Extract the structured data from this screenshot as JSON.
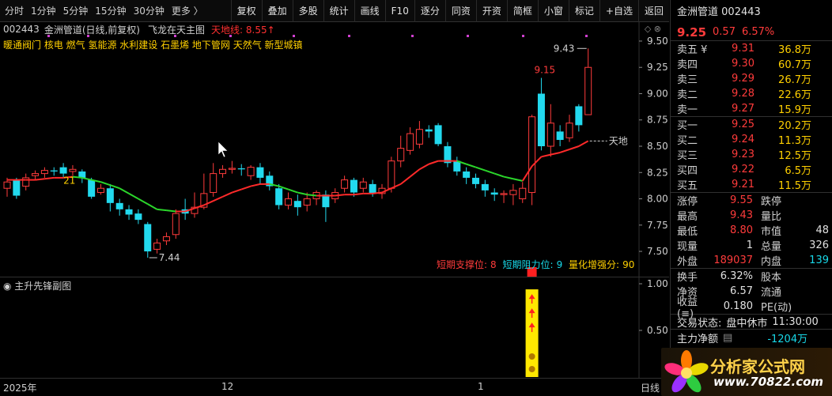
{
  "toolbar": {
    "periods": [
      "分时",
      "1分钟",
      "5分钟",
      "15分钟",
      "30分钟",
      "更多 〉"
    ],
    "buttons": [
      "复权",
      "叠加",
      "多股",
      "统计",
      "画线",
      "F10",
      "逐分",
      "同资",
      "开资",
      "简框",
      "小窗",
      "标记",
      "+自选",
      "返回"
    ]
  },
  "chart_header": {
    "code": "002443",
    "title": "金洲管道(日线,前复权)",
    "indicator": "飞龙在天主图",
    "tiandi": "天地线: 8.55↑"
  },
  "concepts": "暖通阀门 核电 燃气 氢能源 水利建设 石墨烯 地下管网 天然气 新型城镇",
  "main_info": {
    "support_label": "短期支撑位:",
    "support_value": "8",
    "resist_label": "短期阻力位:",
    "resist_value": "9",
    "vol_label": "量化增强分:",
    "vol_value": "90"
  },
  "sub_chart": {
    "title": "主升先锋副图",
    "y_labels": [
      "1.00",
      "0.50"
    ]
  },
  "time_axis": {
    "labels": [
      "2025年",
      "12",
      "1"
    ],
    "right_label": "日线"
  },
  "chart_data": {
    "type": "candlestick",
    "y_ticks": [
      9.5,
      9.25,
      9.0,
      8.75,
      8.5,
      8.25,
      8.0,
      7.75,
      7.5
    ],
    "ylim": [
      7.35,
      9.62
    ],
    "annotations": {
      "high_label": "9.43",
      "low_label": "7.44",
      "peak_label": "9.15",
      "ma_label": "21",
      "tiandi_label": "天地"
    },
    "candles": [
      {
        "o": 8.1,
        "c": 8.16,
        "h": 8.2,
        "l": 8.02
      },
      {
        "o": 8.18,
        "c": 8.03,
        "h": 8.2,
        "l": 8.0
      },
      {
        "o": 8.12,
        "c": 8.2,
        "h": 8.24,
        "l": 8.08
      },
      {
        "o": 8.22,
        "c": 8.24,
        "h": 8.27,
        "l": 8.18
      },
      {
        "o": 8.24,
        "c": 8.27,
        "h": 8.3,
        "l": 8.2
      },
      {
        "o": 8.27,
        "c": 8.26,
        "h": 8.3,
        "l": 8.22
      },
      {
        "o": 8.3,
        "c": 8.24,
        "h": 8.34,
        "l": 8.2
      },
      {
        "o": 8.26,
        "c": 8.28,
        "h": 8.32,
        "l": 8.22
      },
      {
        "o": 8.26,
        "c": 8.2,
        "h": 8.28,
        "l": 8.15
      },
      {
        "o": 8.18,
        "c": 8.02,
        "h": 8.2,
        "l": 8.0
      },
      {
        "o": 8.06,
        "c": 8.1,
        "h": 8.14,
        "l": 8.04
      },
      {
        "o": 8.1,
        "c": 7.96,
        "h": 8.14,
        "l": 7.88
      },
      {
        "o": 7.96,
        "c": 7.9,
        "h": 8.0,
        "l": 7.84
      },
      {
        "o": 7.9,
        "c": 7.85,
        "h": 7.94,
        "l": 7.8
      },
      {
        "o": 7.86,
        "c": 7.8,
        "h": 7.9,
        "l": 7.76
      },
      {
        "o": 7.76,
        "c": 7.5,
        "h": 7.78,
        "l": 7.44
      },
      {
        "o": 7.52,
        "c": 7.58,
        "h": 7.62,
        "l": 7.48
      },
      {
        "o": 7.6,
        "c": 7.64,
        "h": 7.68,
        "l": 7.56
      },
      {
        "o": 7.66,
        "c": 7.86,
        "h": 7.9,
        "l": 7.62
      },
      {
        "o": 7.9,
        "c": 7.86,
        "h": 8.0,
        "l": 7.8
      },
      {
        "o": 7.86,
        "c": 7.92,
        "h": 8.06,
        "l": 7.82
      },
      {
        "o": 7.92,
        "c": 8.05,
        "h": 8.24,
        "l": 7.9
      },
      {
        "o": 8.06,
        "c": 8.24,
        "h": 8.34,
        "l": 8.02
      },
      {
        "o": 8.24,
        "c": 8.28,
        "h": 8.32,
        "l": 8.2
      },
      {
        "o": 8.28,
        "c": 8.29,
        "h": 8.36,
        "l": 8.24
      },
      {
        "o": 8.29,
        "c": 8.28,
        "h": 8.33,
        "l": 8.22
      },
      {
        "o": 8.22,
        "c": 8.3,
        "h": 8.32,
        "l": 8.18
      },
      {
        "o": 8.3,
        "c": 8.2,
        "h": 8.34,
        "l": 8.14
      },
      {
        "o": 8.22,
        "c": 8.12,
        "h": 8.26,
        "l": 8.08
      },
      {
        "o": 8.1,
        "c": 7.94,
        "h": 8.14,
        "l": 7.9
      },
      {
        "o": 7.94,
        "c": 8.0,
        "h": 8.06,
        "l": 7.9
      },
      {
        "o": 7.98,
        "c": 7.92,
        "h": 8.04,
        "l": 7.84
      },
      {
        "o": 7.94,
        "c": 8.0,
        "h": 8.06,
        "l": 7.88
      },
      {
        "o": 8.0,
        "c": 8.06,
        "h": 8.08,
        "l": 7.94
      },
      {
        "o": 8.04,
        "c": 7.92,
        "h": 8.08,
        "l": 7.78
      },
      {
        "o": 8.0,
        "c": 8.06,
        "h": 8.1,
        "l": 7.96
      },
      {
        "o": 8.1,
        "c": 8.18,
        "h": 8.22,
        "l": 8.06
      },
      {
        "o": 8.18,
        "c": 8.06,
        "h": 8.2,
        "l": 8.02
      },
      {
        "o": 8.1,
        "c": 8.16,
        "h": 8.2,
        "l": 8.06
      },
      {
        "o": 8.14,
        "c": 8.05,
        "h": 8.18,
        "l": 8.02
      },
      {
        "o": 8.05,
        "c": 8.1,
        "h": 8.14,
        "l": 8.0
      },
      {
        "o": 8.1,
        "c": 8.36,
        "h": 8.4,
        "l": 8.06
      },
      {
        "o": 8.36,
        "c": 8.48,
        "h": 8.6,
        "l": 8.3
      },
      {
        "o": 8.46,
        "c": 8.62,
        "h": 8.68,
        "l": 8.42
      },
      {
        "o": 8.52,
        "c": 8.66,
        "h": 8.74,
        "l": 8.48
      },
      {
        "o": 8.66,
        "c": 8.64,
        "h": 8.7,
        "l": 8.58
      },
      {
        "o": 8.7,
        "c": 8.52,
        "h": 8.72,
        "l": 8.5
      },
      {
        "o": 8.5,
        "c": 8.34,
        "h": 8.54,
        "l": 8.3
      },
      {
        "o": 8.36,
        "c": 8.26,
        "h": 8.4,
        "l": 8.22
      },
      {
        "o": 8.26,
        "c": 8.2,
        "h": 8.3,
        "l": 8.14
      },
      {
        "o": 8.2,
        "c": 8.14,
        "h": 8.24,
        "l": 8.1
      },
      {
        "o": 8.14,
        "c": 8.08,
        "h": 8.18,
        "l": 8.02
      },
      {
        "o": 8.06,
        "c": 8.04,
        "h": 8.1,
        "l": 7.98
      },
      {
        "o": 8.04,
        "c": 8.05,
        "h": 8.08,
        "l": 7.96
      },
      {
        "o": 8.04,
        "c": 8.08,
        "h": 8.14,
        "l": 7.94
      },
      {
        "o": 8.0,
        "c": 8.1,
        "h": 8.16,
        "l": 7.96
      },
      {
        "o": 8.06,
        "c": 8.78,
        "h": 8.8,
        "l": 7.94
      },
      {
        "o": 9.0,
        "c": 8.5,
        "h": 9.15,
        "l": 8.46
      },
      {
        "o": 8.5,
        "c": 8.72,
        "h": 8.9,
        "l": 8.4
      },
      {
        "o": 8.64,
        "c": 8.56,
        "h": 8.7,
        "l": 8.5
      },
      {
        "o": 8.58,
        "c": 8.72,
        "h": 8.8,
        "l": 8.54
      },
      {
        "o": 8.88,
        "c": 8.7,
        "h": 8.9,
        "l": 8.64
      },
      {
        "o": 8.8,
        "c": 9.25,
        "h": 9.43,
        "l": 8.8
      }
    ],
    "ma_line": [
      8.18,
      8.18,
      8.18,
      8.18,
      8.19,
      8.2,
      8.2,
      8.21,
      8.2,
      8.18,
      8.16,
      8.13,
      8.1,
      8.05,
      8.0,
      7.95,
      7.9,
      7.89,
      7.88,
      7.88,
      7.91,
      7.94,
      7.98,
      8.02,
      8.06,
      8.09,
      8.12,
      8.14,
      8.14,
      8.12,
      8.09,
      8.06,
      8.04,
      8.03,
      8.03,
      8.03,
      8.04,
      8.04,
      8.05,
      8.05,
      8.06,
      8.1,
      8.14,
      8.21,
      8.28,
      8.33,
      8.36,
      8.36,
      8.36,
      8.33,
      8.3,
      8.27,
      8.24,
      8.21,
      8.19,
      8.17,
      8.31,
      8.4,
      8.42,
      8.44,
      8.47,
      8.5,
      8.55
    ],
    "ma_color_up": "#ff2a2a",
    "ma_color_down": "#2bd62b",
    "candle_up": "#ff3b3b",
    "candle_down": "#22d9ee",
    "sub_signals": [
      {
        "index": 56,
        "height_frac": 0.86
      }
    ]
  },
  "right_panel": {
    "stock_name": "金洲管道",
    "stock_code": "002443",
    "price": "9.25",
    "change": "0.57",
    "change_pct": "6.57%",
    "sells": [
      {
        "label": "卖五 ¥",
        "price": "9.31",
        "qty": "36.8万"
      },
      {
        "label": "卖四",
        "price": "9.30",
        "qty": "60.7万"
      },
      {
        "label": "卖三",
        "price": "9.29",
        "qty": "26.7万"
      },
      {
        "label": "卖二",
        "price": "9.28",
        "qty": "22.6万"
      },
      {
        "label": "卖一",
        "price": "9.27",
        "qty": "15.9万"
      }
    ],
    "buys": [
      {
        "label": "买一",
        "price": "9.25",
        "qty": "20.2万"
      },
      {
        "label": "买二",
        "price": "9.24",
        "qty": "11.3万"
      },
      {
        "label": "买三",
        "price": "9.23",
        "qty": "12.5万"
      },
      {
        "label": "买四",
        "price": "9.22",
        "qty": "6.5万"
      },
      {
        "label": "买五",
        "price": "9.21",
        "qty": "11.5万"
      }
    ],
    "stats1": [
      {
        "l1": "涨停",
        "v1": "9.55",
        "l2": "跌停",
        "v2": ""
      },
      {
        "l1": "最高",
        "v1": "9.43",
        "l2": "量比",
        "v2": ""
      },
      {
        "l1": "最低",
        "v1": "8.80",
        "l2": "市值",
        "v2": "48"
      },
      {
        "l1": "现量",
        "v1": "1",
        "l2": "总量",
        "v2": "326"
      },
      {
        "l1": "外盘",
        "v1": "189037",
        "l2": "内盘",
        "v2": "139"
      }
    ],
    "stats2": [
      {
        "l1": "换手",
        "v1": "6.32%",
        "l2": "股本",
        "v2": ""
      },
      {
        "l1": "净资",
        "v1": "6.57",
        "l2": "流通",
        "v2": ""
      },
      {
        "l1": "收益(≡)",
        "v1": "0.180",
        "l2": "PE(动)",
        "v2": ""
      }
    ],
    "status_label": "交易状态:",
    "status_value": "盘中休市",
    "status_time": "11:30:00",
    "net_label": "主力净额",
    "net_value": "-1204万"
  },
  "logo": {
    "text": "分析家公式网",
    "url": "www.70822.com"
  }
}
